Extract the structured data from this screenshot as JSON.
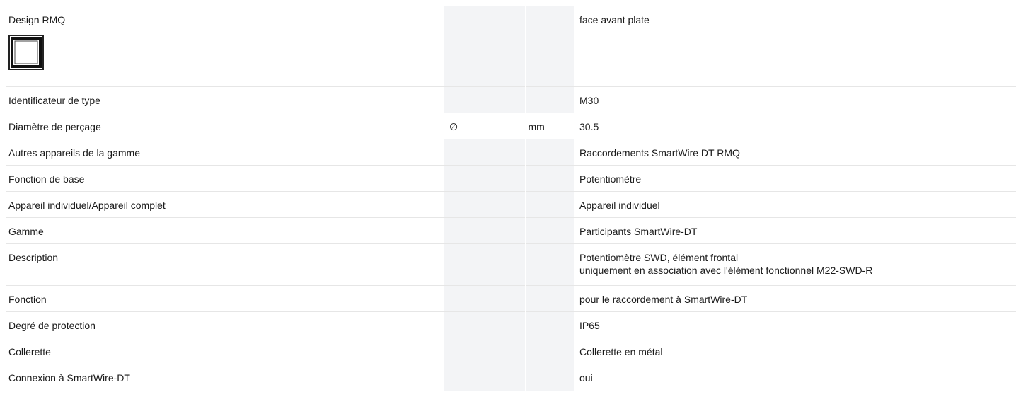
{
  "rows": [
    {
      "label": "Design RMQ",
      "symbol": "",
      "unit": "",
      "value": [
        "face avant plate"
      ],
      "icon": "rmq-flat-front-icon"
    },
    {
      "label": "Identificateur de type",
      "symbol": "",
      "unit": "",
      "value": [
        "M30"
      ]
    },
    {
      "label": "Diamètre de perçage",
      "symbol": "∅",
      "unit": "mm",
      "value": [
        "30.5"
      ]
    },
    {
      "label": "Autres appareils de la gamme",
      "symbol": "",
      "unit": "",
      "value": [
        "Raccordements SmartWire DT RMQ"
      ]
    },
    {
      "label": "Fonction de base",
      "symbol": "",
      "unit": "",
      "value": [
        "Potentiomètre"
      ]
    },
    {
      "label": "Appareil individuel/Appareil complet",
      "symbol": "",
      "unit": "",
      "value": [
        "Appareil individuel"
      ]
    },
    {
      "label": "Gamme",
      "symbol": "",
      "unit": "",
      "value": [
        "Participants SmartWire-DT"
      ]
    },
    {
      "label": "Description",
      "symbol": "",
      "unit": "",
      "value": [
        "Potentiomètre SWD, élément frontal",
        "uniquement en association avec l'élément fonctionnel M22-SWD-R"
      ]
    },
    {
      "label": "Fonction",
      "symbol": "",
      "unit": "",
      "value": [
        "pour le raccordement à SmartWire-DT"
      ]
    },
    {
      "label": "Degré de protection",
      "symbol": "",
      "unit": "",
      "value": [
        "IP65"
      ]
    },
    {
      "label": "Collerette",
      "symbol": "",
      "unit": "",
      "value": [
        "Collerette en métal"
      ]
    },
    {
      "label": "Connexion à SmartWire-DT",
      "symbol": "",
      "unit": "",
      "value": [
        "oui"
      ]
    }
  ],
  "colors": {
    "divider": "#e6e6e6",
    "shaded_column": "#f3f4f6",
    "text": "#1a1a1a"
  }
}
